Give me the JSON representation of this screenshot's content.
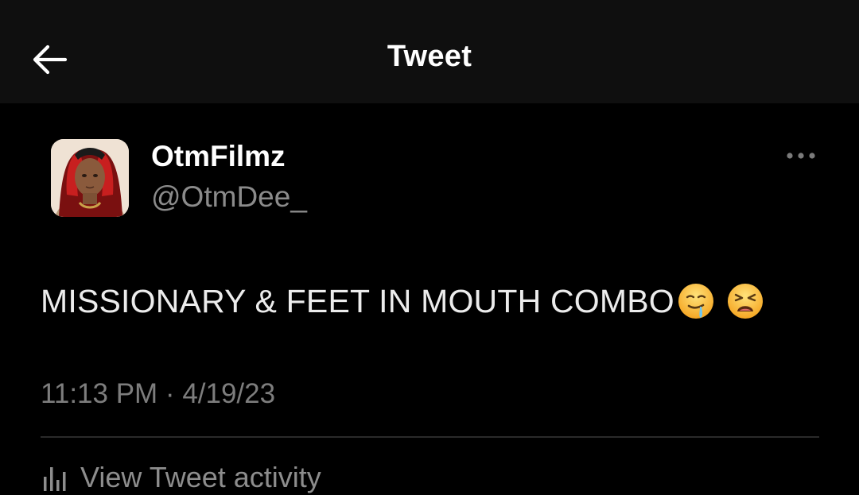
{
  "header": {
    "title": "Tweet"
  },
  "tweet": {
    "author": {
      "display_name": "OtmFilmz",
      "handle": "@OtmDee_"
    },
    "text": "MISSIONARY & FEET IN MOUTH COMBO",
    "emojis": [
      "drooling-face",
      "weary-face"
    ],
    "timestamp": "11:13 PM · 4/19/23",
    "activity_label": "View Tweet activity"
  },
  "icons": {
    "back": "back-arrow-icon",
    "more": "more-horizontal-icon",
    "activity": "bar-chart-icon"
  },
  "colors": {
    "background": "#000000",
    "header_background": "#0f0f0f",
    "primary_text": "#ffffff",
    "secondary_text": "#8b8b8b",
    "divider": "#2a2a2a"
  }
}
